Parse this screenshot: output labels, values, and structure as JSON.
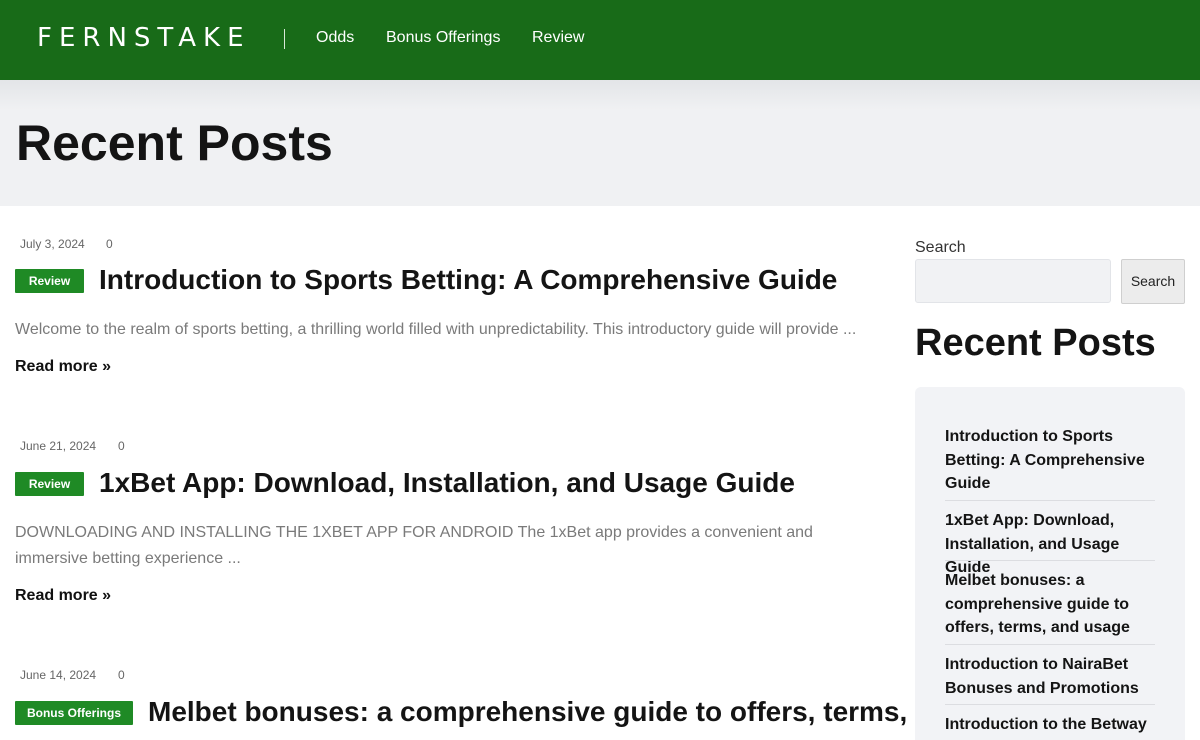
{
  "header": {
    "logo": "FERNSTAKE",
    "nav": [
      "Odds",
      "Bonus Offerings",
      "Review"
    ]
  },
  "page_title": "Recent Posts",
  "posts": [
    {
      "date": "July 3, 2024",
      "comments": "0",
      "category": "Review",
      "title": "Introduction to Sports Betting: A Comprehensive Guide",
      "excerpt": "Welcome to the realm of sports betting, a thrilling world filled with unpredictability. This introductory guide will provide ...",
      "read_more": "Read more »"
    },
    {
      "date": "June 21, 2024",
      "comments": "0",
      "category": "Review",
      "title": "1xBet App: Download, Installation, and Usage Guide",
      "excerpt": "DOWNLOADING AND INSTALLING THE 1XBET APP FOR ANDROID The 1xBet app provides a convenient and immersive betting experience ...",
      "read_more": "Read more »"
    },
    {
      "date": "June 14, 2024",
      "comments": "0",
      "category": "Bonus Offerings",
      "title": "Melbet bonuses: a comprehensive guide to offers, terms,"
    }
  ],
  "sidebar": {
    "search_label": "Search",
    "search_button": "Search",
    "recent_title": "Recent Posts",
    "recent_posts": [
      "Introduction to Sports Betting: A Comprehensive Guide",
      "1xBet App: Download, Installation, and Usage Guide",
      "Melbet bonuses: a comprehensive guide to offers, terms, and usage",
      "Introduction to NairaBet Bonuses and Promotions",
      "Introduction to the Betway"
    ]
  },
  "colors": {
    "header_bg": "#186b18",
    "badge_bg": "#1f8a25",
    "hero_bg": "#f0f1f3",
    "sidebar_box_bg": "#f2f3f6"
  }
}
